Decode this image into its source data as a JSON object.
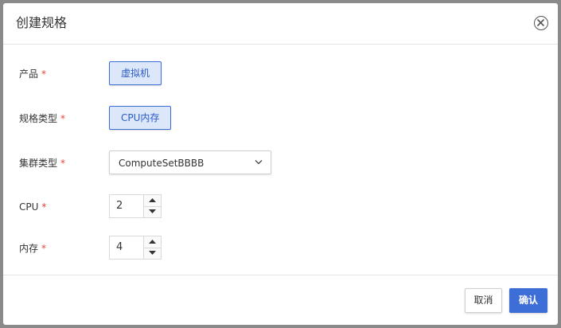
{
  "dialog": {
    "title": "创建规格"
  },
  "form": {
    "required_mark": "*",
    "product": {
      "label": "产品",
      "value": "虚拟机"
    },
    "spec_type": {
      "label": "规格类型",
      "value": "CPU内存"
    },
    "cluster_type": {
      "label": "集群类型",
      "value": "ComputeSetBBBB"
    },
    "cpu": {
      "label": "CPU",
      "value": "2"
    },
    "memory": {
      "label": "内存",
      "value": "4"
    }
  },
  "footer": {
    "cancel_label": "取消",
    "confirm_label": "确认"
  },
  "colors": {
    "accent": "#3d6dd6",
    "required": "#e0463a"
  }
}
